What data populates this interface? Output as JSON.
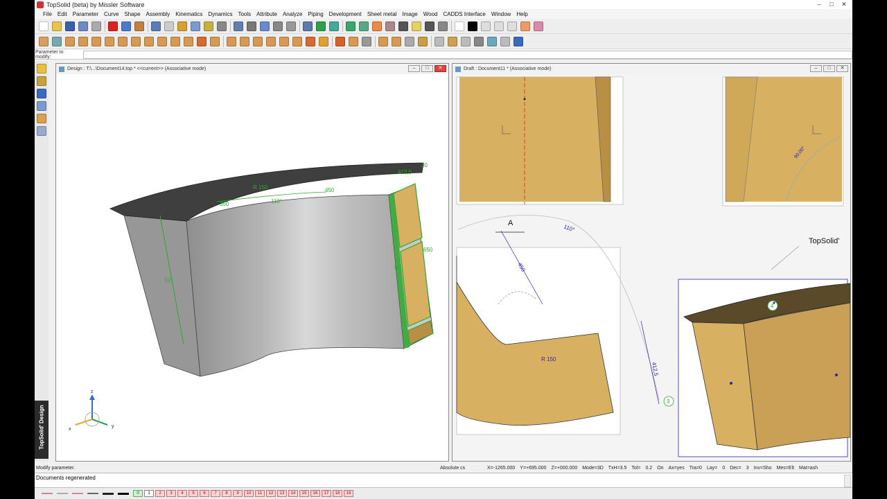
{
  "window": {
    "title": "TopSolid (beta) by Missler Software",
    "minimize": "–",
    "maximize": "□",
    "close": "✕"
  },
  "menu": [
    "File",
    "Edit",
    "Parameter",
    "Curve",
    "Shape",
    "Assembly",
    "Kinematics",
    "Dynamics",
    "Tools",
    "Attribute",
    "Analyze",
    "Piping",
    "Development",
    "Sheet metal",
    "Image",
    "Wood",
    "CADDS Interface",
    "Window",
    "Help"
  ],
  "parameter_bar": {
    "label": "Parameter to modify:",
    "value": ""
  },
  "sidebar": {
    "tab_label": "TopSolid' Design"
  },
  "design_window": {
    "title": "Design : T:\\...\\Document14.top  *  <<current>> (Associative mode)",
    "dims": {
      "r150": "R 150",
      "a110": "110°",
      "d450": "450",
      "d30": "30",
      "d4125": "412,5",
      "d650": "650",
      "d10": "10°",
      "d350": "350",
      "d90": "90"
    },
    "triad": {
      "z": "z",
      "x": "x",
      "y": "y"
    }
  },
  "draft_window": {
    "title": "Draft : Document11 * (Associative mode)",
    "labels": {
      "section": "A",
      "angle": "110°",
      "d450": "450",
      "r150": "R 150",
      "d4125": "412,5",
      "balloon3": "3",
      "balloon4": "4",
      "logo": "TopSolid'",
      "angle2": "90,00°"
    }
  },
  "status": {
    "prompt": "Modify parameter.",
    "coord_system": "Absolute cs",
    "fields": [
      "X=-1265.000",
      "Y=+695.000",
      "Z=+000.000",
      "Mode=3D",
      "TxH=3.5",
      "Tol=",
      "0.2",
      "On",
      "Ax=yes",
      "Tra=0",
      "Lay=",
      "0",
      "Dec=",
      "3",
      "Inv=Sho",
      "Mes=Elt",
      "Mat=ash"
    ]
  },
  "messages": [
    "Documents regenerated"
  ],
  "layers": [
    "0",
    "1",
    "2",
    "3",
    "4",
    "5",
    "6",
    "7",
    "8",
    "9",
    "10",
    "11",
    "12",
    "13",
    "14",
    "15",
    "16",
    "17",
    "18",
    "19"
  ],
  "colors": {
    "wood": "#d8b062",
    "wood_dark": "#b88f45",
    "top": "#3f3f3f",
    "grey_panel": "#a9a9a9",
    "dim_green": "#2ea82e",
    "dim_blue": "#2626a8"
  }
}
